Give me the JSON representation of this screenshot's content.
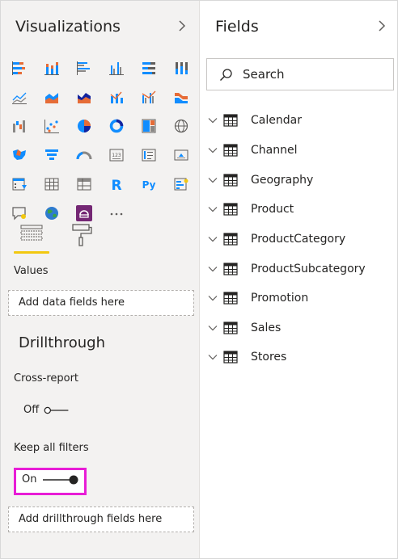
{
  "visualizations": {
    "title": "Visualizations",
    "collapse_icon": "chevron-right-icon"
  },
  "fields_pane": {
    "title": "Fields",
    "collapse_icon": "chevron-right-icon"
  },
  "build_tabs": [
    {
      "name": "fields-tab",
      "icon": "fields-well-icon",
      "active": true
    },
    {
      "name": "format-tab",
      "icon": "paint-roller-icon",
      "active": false
    }
  ],
  "values_section": {
    "label": "Values",
    "placeholder": "Add data fields here"
  },
  "drillthrough": {
    "heading": "Drillthrough",
    "cross_report": {
      "label": "Cross-report",
      "state_label": "Off"
    },
    "keep_all_filters": {
      "label": "Keep all filters",
      "state_label": "On"
    },
    "placeholder": "Add drillthrough fields here"
  },
  "search": {
    "placeholder": "Search"
  },
  "fields": [
    {
      "name": "Calendar"
    },
    {
      "name": "Channel"
    },
    {
      "name": "Geography"
    },
    {
      "name": "Product"
    },
    {
      "name": "ProductCategory"
    },
    {
      "name": "ProductSubcategory"
    },
    {
      "name": "Promotion"
    },
    {
      "name": "Sales"
    },
    {
      "name": "Stores"
    }
  ],
  "more_visuals": "...",
  "colors": {
    "accent_yellow": "#f2c811",
    "highlight_magenta": "#e81dd6",
    "toggle_dark": "#252423"
  }
}
